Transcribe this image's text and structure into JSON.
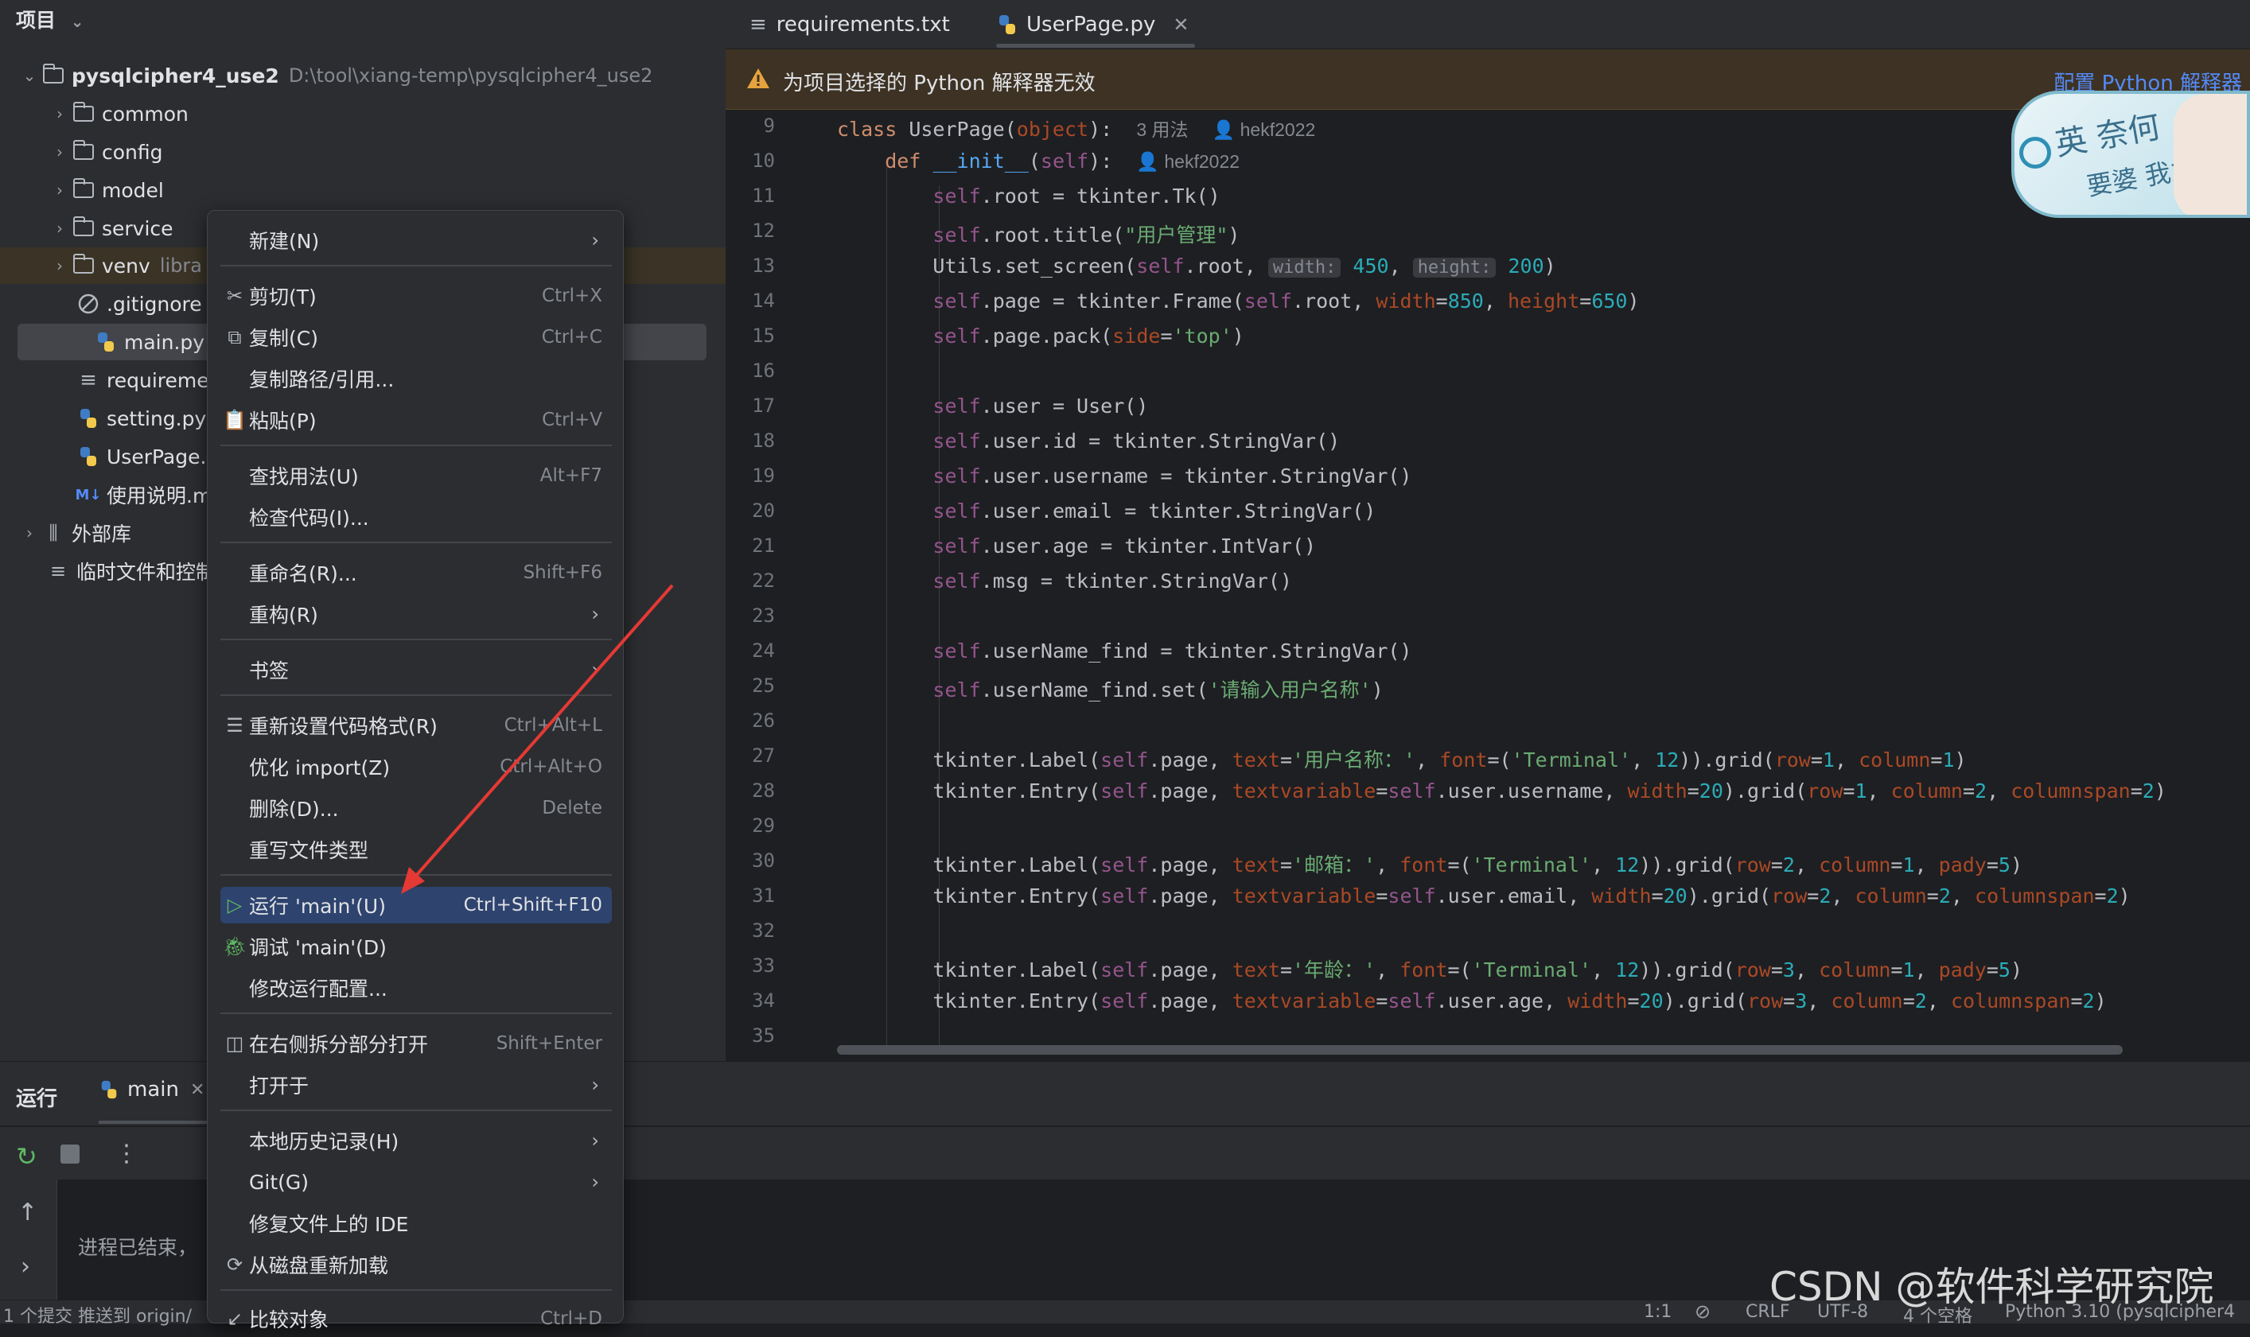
{
  "project": {
    "header": "项目",
    "root_name": "pysqlcipher4_use2",
    "root_path": "D:\\tool\\xiang-temp\\pysqlcipher4_use2",
    "items": [
      {
        "label": "common"
      },
      {
        "label": "config"
      },
      {
        "label": "model"
      },
      {
        "label": "service"
      },
      {
        "label": "venv",
        "suffix": "libra"
      },
      {
        "label": ".gitignore"
      },
      {
        "label": "main.py"
      },
      {
        "label": "requireme"
      },
      {
        "label": "setting.py"
      },
      {
        "label": "UserPage.p"
      },
      {
        "label": "使用说明.m"
      },
      {
        "label": "外部库"
      },
      {
        "label": "临时文件和控制"
      }
    ]
  },
  "tabs": [
    {
      "label": "requirements.txt"
    },
    {
      "label": "UserPage.py"
    }
  ],
  "banner": {
    "message": "为项目选择的 Python 解释器无效",
    "link": "配置 Python 解释器"
  },
  "code": {
    "line_numbers": [
      "9",
      "10",
      "11",
      "12",
      "13",
      "14",
      "15",
      "16",
      "17",
      "18",
      "19",
      "20",
      "21",
      "22",
      "23",
      "24",
      "25",
      "26",
      "27",
      "28",
      "29",
      "30",
      "31",
      "32",
      "33",
      "34",
      "35"
    ],
    "usages": "3 用法",
    "author": "hekf2022",
    "hint_width": "width:",
    "hint_height": "height:"
  },
  "context_menu": {
    "items": [
      {
        "label": "新建(N)",
        "shortcut": "",
        "submenu": true
      },
      {
        "label": "剪切(T)",
        "shortcut": "Ctrl+X",
        "icon": "scissors-icon"
      },
      {
        "label": "复制(C)",
        "shortcut": "Ctrl+C",
        "icon": "copy-icon"
      },
      {
        "label": "复制路径/引用...",
        "shortcut": ""
      },
      {
        "label": "粘贴(P)",
        "shortcut": "Ctrl+V",
        "icon": "paste-icon"
      },
      {
        "label": "查找用法(U)",
        "shortcut": "Alt+F7"
      },
      {
        "label": "检查代码(I)...",
        "shortcut": ""
      },
      {
        "label": "重命名(R)...",
        "shortcut": "Shift+F6"
      },
      {
        "label": "重构(R)",
        "shortcut": "",
        "submenu": true
      },
      {
        "label": "书签",
        "shortcut": "",
        "submenu": true
      },
      {
        "label": "重新设置代码格式(R)",
        "shortcut": "Ctrl+Alt+L",
        "icon": "reformat-icon"
      },
      {
        "label": "优化 import(Z)",
        "shortcut": "Ctrl+Alt+O"
      },
      {
        "label": "删除(D)...",
        "shortcut": "Delete"
      },
      {
        "label": "重写文件类型",
        "shortcut": ""
      },
      {
        "label": "运行 'main'(U)",
        "shortcut": "Ctrl+Shift+F10",
        "icon": "run-icon",
        "selected": true
      },
      {
        "label": "调试 'main'(D)",
        "shortcut": "",
        "icon": "debug-icon"
      },
      {
        "label": "修改运行配置...",
        "shortcut": ""
      },
      {
        "label": "在右侧拆分部分打开",
        "shortcut": "Shift+Enter",
        "icon": "split-icon"
      },
      {
        "label": "打开于",
        "shortcut": "",
        "submenu": true
      },
      {
        "label": "本地历史记录(H)",
        "shortcut": "",
        "submenu": true
      },
      {
        "label": "Git(G)",
        "shortcut": "",
        "submenu": true
      },
      {
        "label": "修复文件上的 IDE",
        "shortcut": ""
      },
      {
        "label": "从磁盘重新加载",
        "shortcut": "",
        "icon": "reload-icon"
      },
      {
        "label": "比较对象",
        "shortcut": "Ctrl+D",
        "icon": "compare-icon"
      }
    ]
  },
  "run_panel": {
    "title": "运行",
    "tab": "main",
    "output": "进程已结束，"
  },
  "status_bar": {
    "left": "1 个提交 推送到 origin/",
    "position": "1:1",
    "line_sep": "CRLF",
    "encoding": "UTF-8",
    "indent": "4 个空格",
    "interpreter": "Python 3.10 (pysqlcipher4"
  },
  "watermark": "CSDN @软件科学研究院",
  "colors": {
    "accent": "#2e436e",
    "warning": "#e6a23c",
    "link": "#548af7",
    "arrow": "#e53935"
  }
}
